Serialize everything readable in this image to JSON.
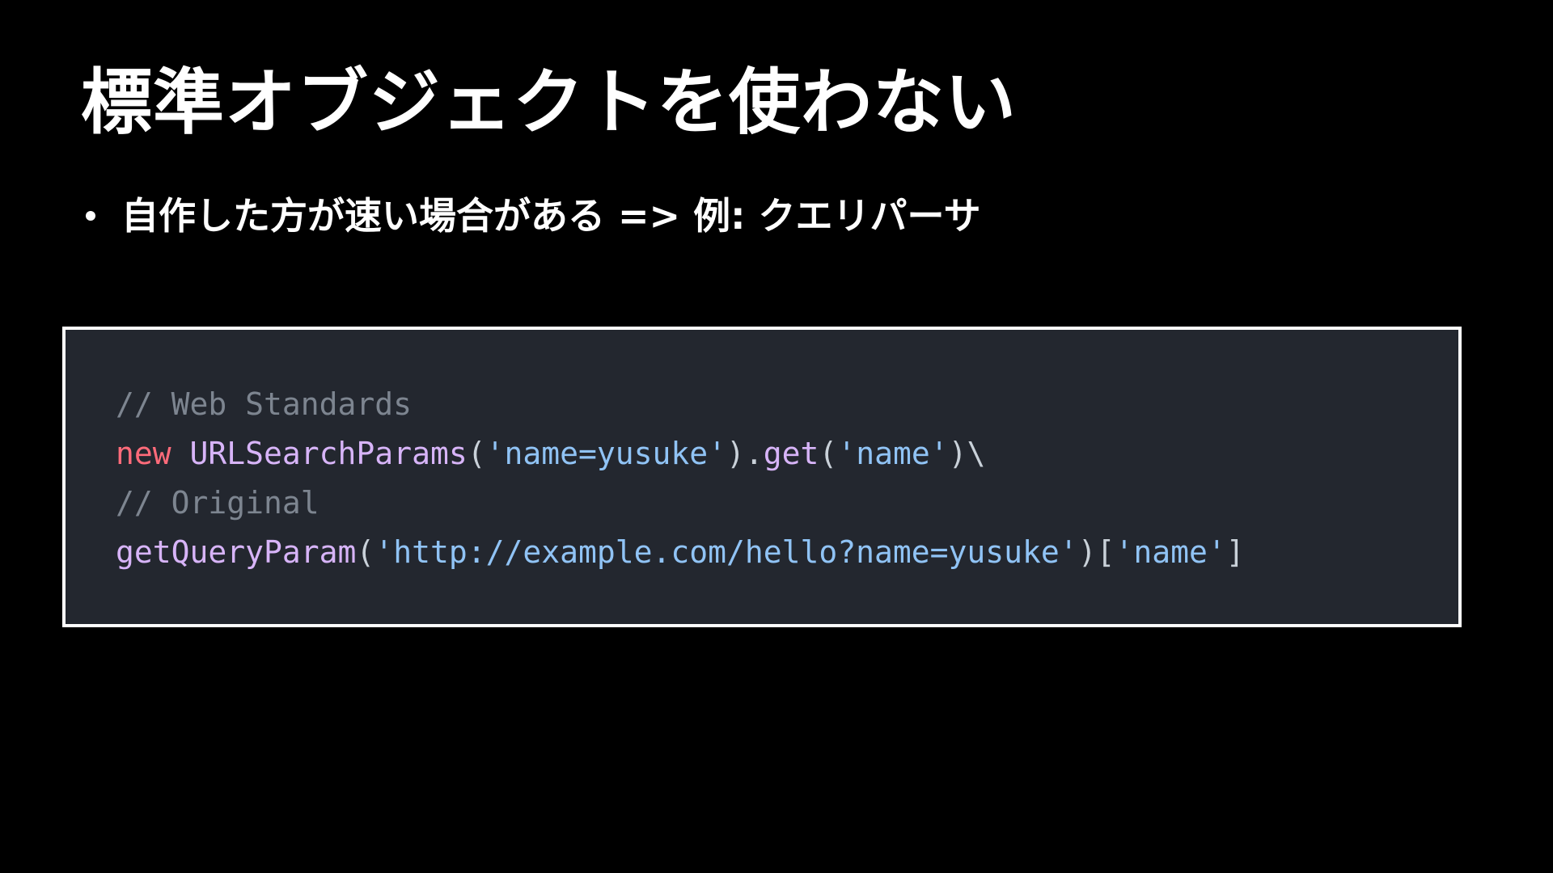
{
  "slide": {
    "title": "標準オブジェクトを使わない",
    "bullets": [
      "自作した方が速い場合がある => 例: クエリパーサ"
    ]
  },
  "code": {
    "line1": {
      "comment": "// Web Standards"
    },
    "line2": {
      "keyword": "new",
      "space": " ",
      "class_name": "URLSearchParams",
      "open": "(",
      "arg": "'name=yusuke'",
      "close_dot": ").",
      "method": "get",
      "open2": "(",
      "arg2": "'name'",
      "close2": ")\\"
    },
    "line3": {
      "comment": "// Original"
    },
    "line4": {
      "func": "getQueryParam",
      "open": "(",
      "arg": "'http://example.com/hello?name=yusuke'",
      "close_bracket": ")[",
      "key": "'name'",
      "end": "]"
    }
  },
  "colors": {
    "background": "#000000",
    "code_background": "#23272f",
    "code_border": "#ffffff",
    "comment": "#7d8590",
    "keyword": "#ff6b7a",
    "function": "#d7b4f8",
    "string": "#90c3f5"
  }
}
